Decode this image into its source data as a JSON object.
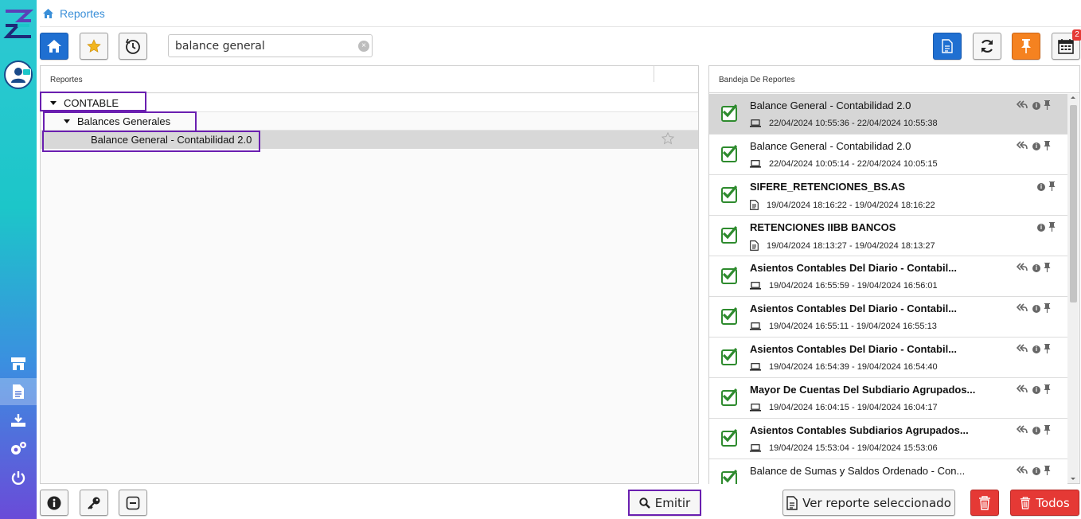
{
  "breadcrumb": {
    "label": "Reportes"
  },
  "search": {
    "value": "balance general",
    "clear_glyph": "×"
  },
  "calendar_badge": "2",
  "left_panel": {
    "header": "Reportes",
    "tree": [
      {
        "label": "CONTABLE"
      },
      {
        "label": "Balances Generales"
      },
      {
        "label": "Balance General - Contabilidad 2.0"
      }
    ]
  },
  "right_panel": {
    "header": "Bandeja De Reportes",
    "reports": [
      {
        "title": "Balance General - Contabilidad 2.0",
        "dates": "22/04/2024 10:55:36 - 22/04/2024 10:55:38",
        "bold": false,
        "source": "laptop-icon",
        "reply": true
      },
      {
        "title": "Balance General - Contabilidad 2.0",
        "dates": "22/04/2024 10:05:14 - 22/04/2024 10:05:15",
        "bold": false,
        "source": "laptop-icon",
        "reply": true
      },
      {
        "title": "SIFERE_RETENCIONES_BS.AS",
        "dates": "19/04/2024 18:16:22 - 19/04/2024 18:16:22",
        "bold": true,
        "source": "document-icon",
        "reply": false
      },
      {
        "title": "RETENCIONES IIBB BANCOS",
        "dates": "19/04/2024 18:13:27 - 19/04/2024 18:13:27",
        "bold": true,
        "source": "document-icon",
        "reply": false
      },
      {
        "title": "Asientos Contables Del Diario - Contabil...",
        "dates": "19/04/2024 16:55:59 - 19/04/2024 16:56:01",
        "bold": true,
        "source": "laptop-icon",
        "reply": true
      },
      {
        "title": "Asientos Contables Del Diario - Contabil...",
        "dates": "19/04/2024 16:55:11 - 19/04/2024 16:55:13",
        "bold": true,
        "source": "laptop-icon",
        "reply": true
      },
      {
        "title": "Asientos Contables Del Diario - Contabil...",
        "dates": "19/04/2024 16:54:39 - 19/04/2024 16:54:40",
        "bold": true,
        "source": "laptop-icon",
        "reply": true
      },
      {
        "title": "Mayor De Cuentas Del Subdiario Agrupados...",
        "dates": "19/04/2024 16:04:15 - 19/04/2024 16:04:17",
        "bold": true,
        "source": "laptop-icon",
        "reply": true
      },
      {
        "title": "Asientos Contables Subdiarios Agrupados...",
        "dates": "19/04/2024 15:53:04 - 19/04/2024 15:53:06",
        "bold": true,
        "source": "laptop-icon",
        "reply": true
      },
      {
        "title": "Balance de Sumas y Saldos Ordenado - Con...",
        "dates": "",
        "bold": false,
        "source": "laptop-icon",
        "reply": true
      }
    ]
  },
  "bottom": {
    "emitir_label": "Emitir",
    "ver_reporte_label": "Ver reporte seleccionado",
    "todos_label": "Todos"
  },
  "colors": {
    "accent": "#1f6fd1",
    "orange": "#f58220",
    "danger": "#e53935",
    "highlight": "#6a1fb0",
    "check": "#2e8b2e"
  }
}
